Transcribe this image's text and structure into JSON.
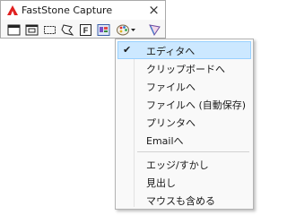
{
  "window": {
    "title": "FastStone Capture",
    "close_glyph": "×"
  },
  "toolbar": {
    "buttons": [
      {
        "name": "capture-active-window-icon"
      },
      {
        "name": "capture-window-object-icon"
      },
      {
        "name": "capture-rectangular-region-icon"
      },
      {
        "name": "capture-freehand-region-icon"
      },
      {
        "name": "capture-full-screen-icon"
      },
      {
        "name": "capture-scrolling-window-icon"
      },
      {
        "name": "output-destination-icon"
      },
      {
        "name": "settings-icon"
      }
    ]
  },
  "menu": {
    "check_glyph": "✔",
    "items": [
      {
        "label": "エディタへ",
        "checked": true
      },
      {
        "label": "クリップボードへ",
        "checked": false
      },
      {
        "label": "ファイルへ",
        "checked": false
      },
      {
        "label": "ファイルへ (自動保存)",
        "checked": false
      },
      {
        "label": "プリンタへ",
        "checked": false
      },
      {
        "label": "Emailへ",
        "checked": false
      },
      {
        "label": "エッジ/すかし",
        "checked": false
      },
      {
        "label": "見出し",
        "checked": false
      },
      {
        "label": "マウスも含める",
        "checked": false
      }
    ]
  },
  "colors": {
    "menu_highlight": "#cce8ff",
    "logo_red": "#e02020"
  }
}
